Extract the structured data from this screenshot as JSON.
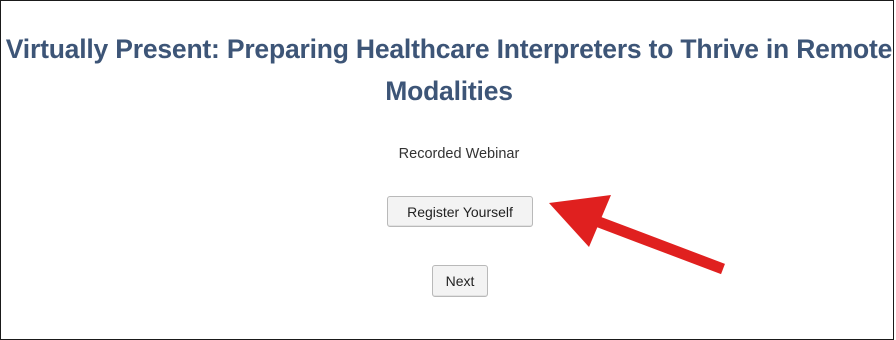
{
  "page": {
    "title": "Virtually Present: Preparing Healthcare Interpreters to Thrive in Remote Modalities",
    "subtitle": "Recorded Webinar"
  },
  "buttons": {
    "register_label": "Register Yourself",
    "next_label": "Next"
  },
  "annotation": {
    "arrow_color": "#e0201f",
    "points_to": "register-button"
  }
}
